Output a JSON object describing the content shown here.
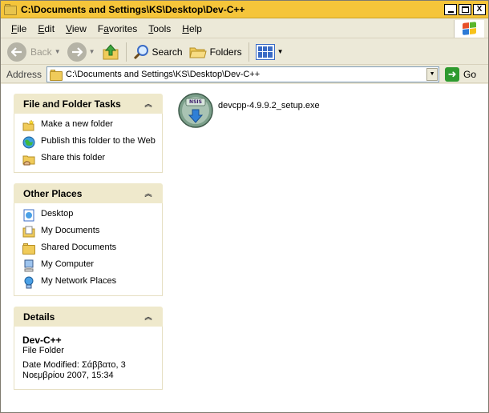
{
  "window": {
    "title": "C:\\Documents and Settings\\KS\\Desktop\\Dev-C++",
    "controls": {
      "minimize": "_",
      "maximize": "□",
      "close": "X"
    }
  },
  "menu": {
    "items": [
      {
        "label": "File",
        "key": "F",
        "rest": "ile"
      },
      {
        "label": "Edit",
        "key": "E",
        "rest": "dit"
      },
      {
        "label": "View",
        "key": "V",
        "rest": "iew"
      },
      {
        "label": "Favorites",
        "key": "",
        "pre": "F",
        "mid": "a",
        "post": "vorites"
      },
      {
        "label": "Tools",
        "key": "T",
        "rest": "ools"
      },
      {
        "label": "Help",
        "key": "H",
        "rest": "elp"
      }
    ]
  },
  "toolbar": {
    "back_label": "Back",
    "search_label": "Search",
    "folders_label": "Folders"
  },
  "address": {
    "label": "Address",
    "path": "C:\\Documents and Settings\\KS\\Desktop\\Dev-C++",
    "go_label": "Go"
  },
  "taskpane": {
    "file_tasks": {
      "title": "File and Folder Tasks",
      "items": [
        {
          "label": "Make a new folder",
          "icon": "new-folder-icon"
        },
        {
          "label": "Publish this folder to the Web",
          "icon": "publish-web-icon"
        },
        {
          "label": "Share this folder",
          "icon": "share-folder-icon"
        }
      ]
    },
    "other_places": {
      "title": "Other Places",
      "items": [
        {
          "label": "Desktop",
          "icon": "desktop-icon"
        },
        {
          "label": "My Documents",
          "icon": "my-documents-icon"
        },
        {
          "label": "Shared Documents",
          "icon": "shared-documents-icon"
        },
        {
          "label": "My Computer",
          "icon": "my-computer-icon"
        },
        {
          "label": "My Network Places",
          "icon": "network-places-icon"
        }
      ]
    },
    "details": {
      "title": "Details",
      "name": "Dev-C++",
      "type": "File Folder",
      "modified_line1": "Date Modified: Σάββατο, 3",
      "modified_line2": "Νοεμβρίου 2007, 15:34"
    }
  },
  "files": [
    {
      "name": "devcpp-4.9.9.2_setup.exe",
      "icon": "nsis-installer-icon",
      "icon_text": "NSIS"
    }
  ],
  "colors": {
    "titlebar": "#f5c53a",
    "chrome": "#ece9d8",
    "panel_header": "#efe9cc"
  }
}
